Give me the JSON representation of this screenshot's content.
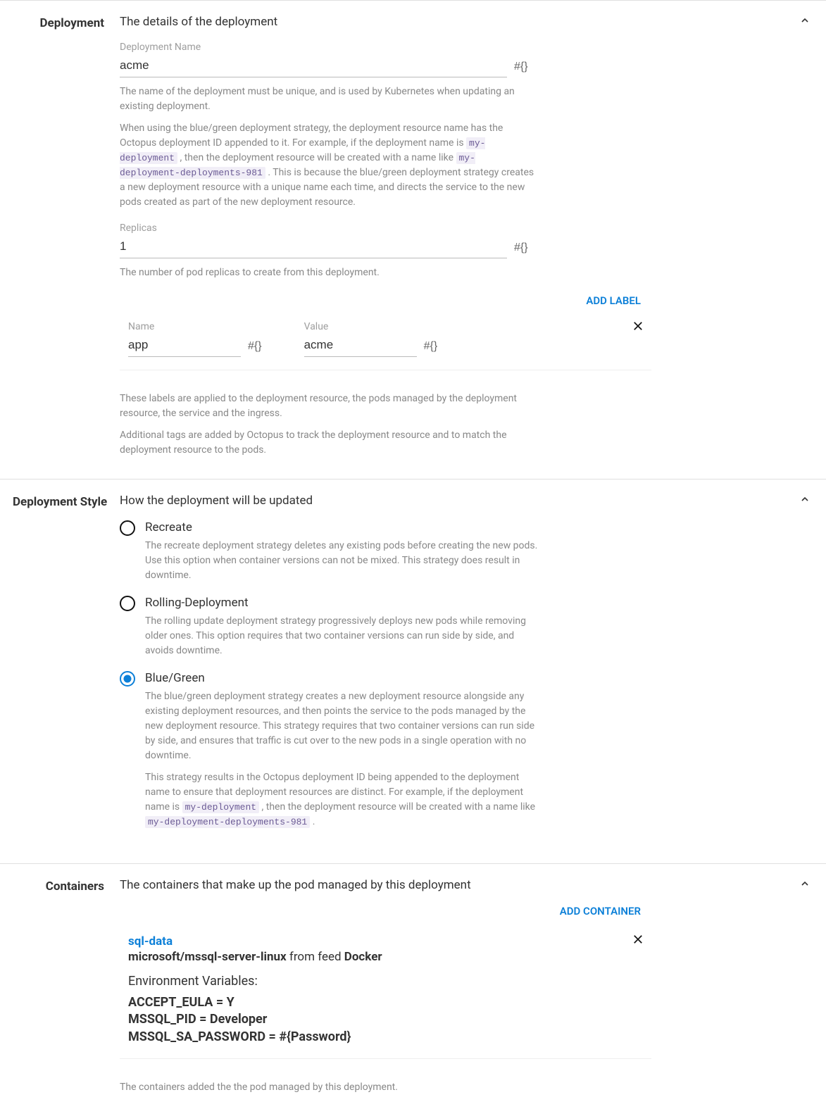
{
  "sections": {
    "deployment": {
      "label": "Deployment",
      "subtitle": "The details of the deployment",
      "name_field_label": "Deployment Name",
      "name_value": "acme",
      "name_helper1": "The name of the deployment must be unique, and is used by Kubernetes when updating an existing deployment.",
      "name_helper2_pre": "When using the blue/green deployment strategy, the deployment resource name has the Octopus deployment ID appended to it. For example, if the deployment name is ",
      "name_helper2_code1": "my-deployment",
      "name_helper2_mid": ", then the deployment resource will be created with a name like ",
      "name_helper2_code2": "my-deployment-deployments-981",
      "name_helper2_post": ". This is because the blue/green deployment strategy creates a new deployment resource with a unique name each time, and directs the service to the new pods created as part of the new deployment resource.",
      "replicas_label": "Replicas",
      "replicas_value": "1",
      "replicas_helper": "The number of pod replicas to create from this deployment.",
      "add_label_link": "ADD LABEL",
      "kv": {
        "name_label": "Name",
        "name_value": "app",
        "value_label": "Value",
        "value_value": "acme"
      },
      "labels_helper1": "These labels are applied to the deployment resource, the pods managed by the deployment resource, the service and the ingress.",
      "labels_helper2": "Additional tags are added by Octopus to track the deployment resource and to match the deployment resource to the pods."
    },
    "style": {
      "label": "Deployment Style",
      "subtitle": "How the deployment will be updated",
      "options": {
        "recreate": {
          "title": "Recreate",
          "desc": "The recreate deployment strategy deletes any existing pods before creating the new pods. Use this option when container versions can not be mixed. This strategy does result in downtime."
        },
        "rolling": {
          "title": "Rolling-Deployment",
          "desc": "The rolling update deployment strategy progressively deploys new pods while removing older ones. This option requires that two container versions can run side by side, and avoids downtime."
        },
        "bluegreen": {
          "title": "Blue/Green",
          "desc1": "The blue/green deployment strategy creates a new deployment resource alongside any existing deployment resources, and then points the service to the pods managed by the new deployment resource. This strategy requires that two container versions can run side by side, and ensures that traffic is cut over to the new pods in a single operation with no downtime.",
          "desc2_pre": "This strategy results in the Octopus deployment ID being appended to the deployment name to ensure that deployment resources are distinct. For example, if the deployment name is ",
          "desc2_code1": "my-deployment",
          "desc2_mid": ", then the deployment resource will be created with a name like ",
          "desc2_code2": "my-deployment-deployments-981",
          "desc2_post": "."
        }
      }
    },
    "containers": {
      "label": "Containers",
      "subtitle": "The containers that make up the pod managed by this deployment",
      "add_container_link": "ADD CONTAINER",
      "card": {
        "name": "sql-data",
        "image": "microsoft/mssql-server-linux",
        "from_feed_text": " from feed ",
        "feed": "Docker",
        "env_title": "Environment Variables:",
        "env1": "ACCEPT_EULA = Y",
        "env2": "MSSQL_PID = Developer",
        "env3": "MSSQL_SA_PASSWORD = #{Password}"
      },
      "helper": "The containers added the the pod managed by this deployment."
    }
  },
  "bind_glyph": "#{}"
}
